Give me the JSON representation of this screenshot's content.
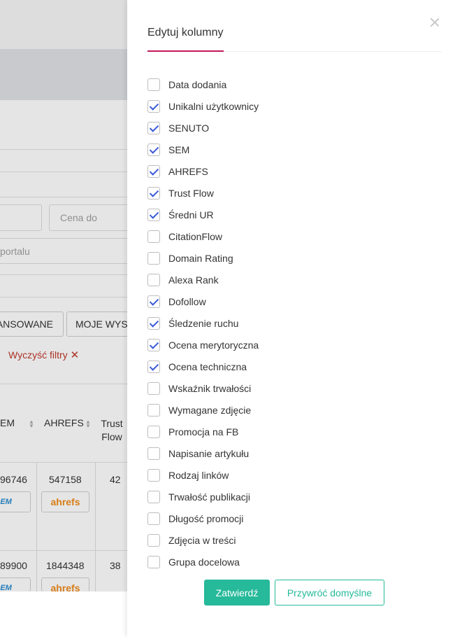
{
  "background": {
    "price_to_placeholder": "Cena do",
    "portal_placeholder": "portalu",
    "button_advanced": "ANSOWANE",
    "button_my_searches": "MOJE WYSZ",
    "clear_filters": "Wyczyść filtry",
    "table": {
      "headers": [
        "EM",
        "AHREFS",
        "Trust Flow"
      ],
      "rows": [
        {
          "sem": "96746",
          "ahrefs": "547158",
          "trust_flow": "42"
        },
        {
          "sem": "89900",
          "ahrefs": "1844348",
          "trust_flow": "38"
        }
      ],
      "badge_sem": "SEM",
      "badge_ahrefs": "ahrefs"
    }
  },
  "drawer": {
    "title": "Edytuj kolumny",
    "columns": [
      {
        "label": "Data dodania",
        "checked": false
      },
      {
        "label": "Unikalni użytkownicy",
        "checked": true
      },
      {
        "label": "SENUTO",
        "checked": true
      },
      {
        "label": "SEM",
        "checked": true
      },
      {
        "label": "AHREFS",
        "checked": true
      },
      {
        "label": "Trust Flow",
        "checked": true
      },
      {
        "label": "Średni UR",
        "checked": true
      },
      {
        "label": "CitationFlow",
        "checked": false
      },
      {
        "label": "Domain Rating",
        "checked": false
      },
      {
        "label": "Alexa Rank",
        "checked": false
      },
      {
        "label": "Dofollow",
        "checked": true
      },
      {
        "label": "Śledzenie ruchu",
        "checked": true
      },
      {
        "label": "Ocena merytoryczna",
        "checked": true
      },
      {
        "label": "Ocena techniczna",
        "checked": true
      },
      {
        "label": "Wskaźnik trwałości",
        "checked": false
      },
      {
        "label": "Wymagane zdjęcie",
        "checked": false
      },
      {
        "label": "Promocja na FB",
        "checked": false
      },
      {
        "label": "Napisanie artykułu",
        "checked": false
      },
      {
        "label": "Rodzaj linków",
        "checked": false
      },
      {
        "label": "Trwałość publikacji",
        "checked": false
      },
      {
        "label": "Długość promocji",
        "checked": false
      },
      {
        "label": "Zdjęcia w treści",
        "checked": false
      },
      {
        "label": "Grupa docelowa",
        "checked": false
      }
    ],
    "confirm_label": "Zatwierdź",
    "reset_label": "Przywróć domyślne"
  },
  "colors": {
    "accent": "#c2185b",
    "primary": "#26b99a",
    "checkmark": "#3b5bdb",
    "danger": "#c0392b"
  }
}
